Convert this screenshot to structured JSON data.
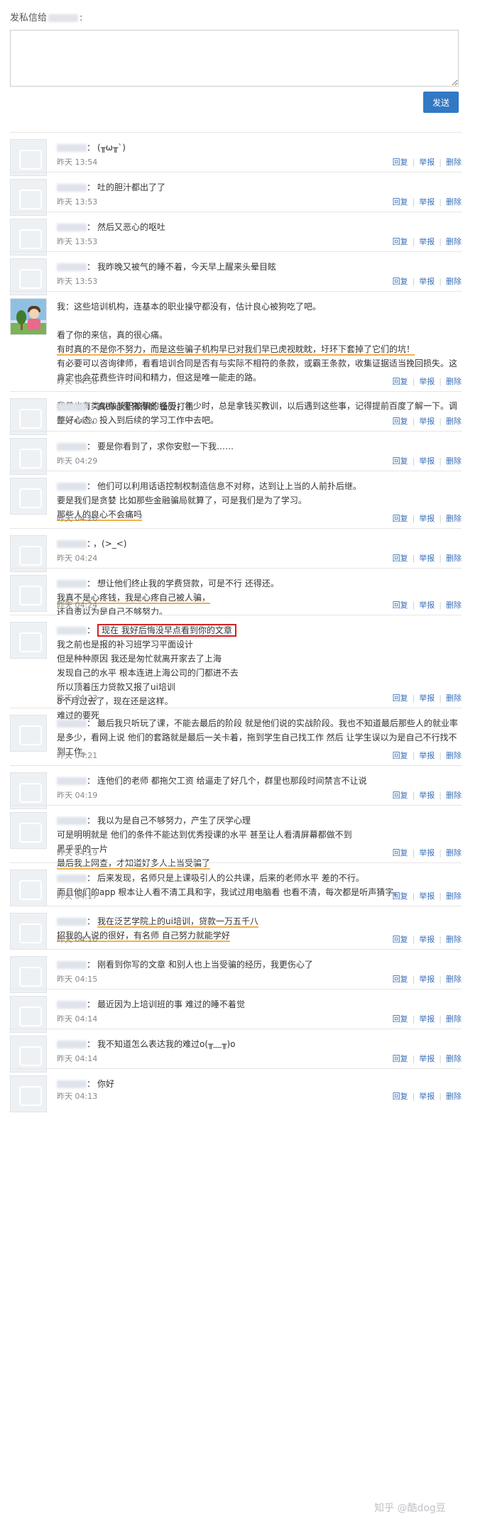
{
  "header": {
    "prefix": "发私信给",
    "name_suffix": ":"
  },
  "input": {
    "value": "",
    "placeholder": ""
  },
  "send_label": "发送",
  "actions": {
    "reply": "回复",
    "report": "举报",
    "delete": "删除"
  },
  "messages": [
    {
      "text": "(╥ω╥`)",
      "time": "昨天 13:54"
    },
    {
      "text": "吐的胆汁都出了了",
      "time": "昨天 13:53"
    },
    {
      "text": "然后又恶心的呕吐",
      "time": "昨天 13:53"
    },
    {
      "text": "我昨晚又被气的睡不着，今天早上醒来头晕目眩",
      "time": "昨天 13:53"
    },
    {
      "self": true,
      "prefix": "我：",
      "lines": [
        "这些培训机构，连基本的职业操守都没有，估计良心被狗吃了吧。",
        "",
        "看了你的来信，真的很心痛。",
        "有时真的不是你不努力，而是这些骗子机构早已对我们早已虎视眈眈，圩环下套掉了它们的坑！",
        "有必要可以咨询律师，看看培训合同是否有与实际不相符的条款，或霸王条款，收集证据适当挽回损失。这肯定也会花费些许时间和精力，但这是唯一能走的路。",
        "",
        "我曾也有类似做兼职被骗的经历，年少时，总是拿钱买教训，以后遇到这些事，记得提前百度了解一下。调整好心态，投入到后续的学习工作中去吧。"
      ],
      "time": "昨天 04:58"
    },
    {
      "text": "真的心里猜得慌 备受打击",
      "time": "昨天 04:30"
    },
    {
      "text": "要是你看到了，求你安慰一下我……",
      "time": "昨天 04:29"
    },
    {
      "lines": [
        "他们可以利用话语控制权制造信息不对称，达到让上当的人前扑后继。",
        "要是我们是贪婪 比如那些金融骗局就算了，可是我们是为了学习。",
        "那些人的良心不会痛吗"
      ],
      "time": "昨天 04:28"
    },
    {
      "text": "，(>_<)",
      "time": "昨天 04:24"
    },
    {
      "lines": [
        "想让他们终止我的学费贷款，可是不行 还得还。",
        "我真不是心疼钱，我是心疼自己被人骗，",
        "还自责以为是自己不够努力。"
      ],
      "time": "昨天 04:24"
    },
    {
      "lines": [
        "现在 我好后悔没早点看到你的文章",
        "我之前也是报的补习班学习平面设计",
        "但是种种原因 我还是匆忙就离开家去了上海",
        "发现自己的水平 根本连进上海公司的门都进不去",
        "所以顶着压力贷款又报了ui培训",
        "8个月过去了，现在还是这样。",
        "难过的要死"
      ],
      "time": "昨天 04:23"
    },
    {
      "lines": [
        "最后我只听玩了课，不能去最后的阶段 就是他们说的实战阶段。我也不知道最后那些人的就业率是多少，看网上说 他们的套路就是最后一关卡着，拖到学生自己找工作 然后 让学生误以为是自己不行找不到工作。"
      ],
      "time": "昨天 04:21"
    },
    {
      "text": "连他们的老师 都拖欠工资 给逼走了好几个，群里也那段时间禁言不让说",
      "time": "昨天 04:19"
    },
    {
      "lines": [
        "我以为是自己不够努力，产生了厌学心理",
        "可是明明就是 他们的条件不能达到优秀授课的水平 甚至让人看清屏幕都做不到",
        "黑乎乎的一片",
        "最后我上网查，才知道好多人上当受骗了"
      ],
      "time": "昨天 04:19"
    },
    {
      "lines": [
        "后来发现，名师只是上课吸引人的公共课，后来的老师水平 差的不行。",
        "而且他们的app 根本让人看不清工具和字，我试过用电脑看 也看不清，每次都是听声猜字。"
      ],
      "time": "昨天 04:17"
    },
    {
      "lines": [
        "我在泛艺学院上的ui培训，贷款一万五千八",
        "招我的人说的很好，有名师 自己努力就能学好"
      ],
      "time": "昨天 04:16"
    },
    {
      "text": "刚看到你写的文章 和别人也上当受骗的经历，我更伤心了",
      "time": "昨天 04:15"
    },
    {
      "text": "最近因为上培训班的事 难过的睡不着觉",
      "time": "昨天 04:14"
    },
    {
      "text": "我不知道怎么表达我的难过o(╥﹏╥)o",
      "time": "昨天 04:14"
    },
    {
      "text": "你好",
      "time": "昨天 04:13"
    }
  ],
  "watermark": "知乎 @酷dog豆"
}
